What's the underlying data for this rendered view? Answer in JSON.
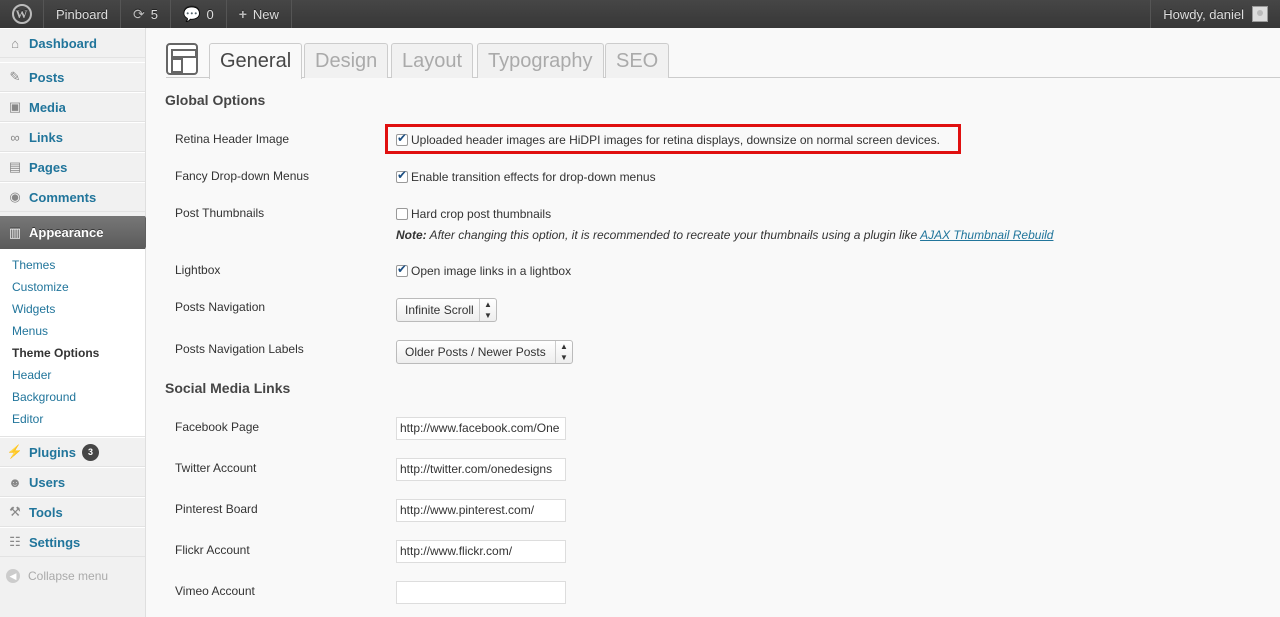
{
  "adminbar": {
    "site_name": "Pinboard",
    "updates_count": "5",
    "comments_count": "0",
    "new_label": "New",
    "howdy": "Howdy, daniel"
  },
  "menu": {
    "dashboard": "Dashboard",
    "posts": "Posts",
    "media": "Media",
    "links": "Links",
    "pages": "Pages",
    "comments": "Comments",
    "appearance": "Appearance",
    "appearance_sub": [
      "Themes",
      "Customize",
      "Widgets",
      "Menus",
      "Theme Options",
      "Header",
      "Background",
      "Editor"
    ],
    "plugins": "Plugins",
    "plugins_badge": "3",
    "users": "Users",
    "tools": "Tools",
    "settings": "Settings",
    "collapse": "Collapse menu"
  },
  "tabs": [
    "General",
    "Design",
    "Layout",
    "Typography",
    "SEO"
  ],
  "global": {
    "heading": "Global Options",
    "retina_label": "Retina Header Image",
    "retina_text": "Uploaded header images are HiDPI images for retina displays, downsize on normal screen devices.",
    "fancy_label": "Fancy Drop-down Menus",
    "fancy_text": "Enable transition effects for drop-down menus",
    "thumbs_label": "Post Thumbnails",
    "thumbs_text": "Hard crop post thumbnails",
    "note_prefix": "Note:",
    "note_text": " After changing this option, it is recommended to recreate your thumbnails using a plugin like ",
    "note_link": "AJAX Thumbnail Rebuild",
    "lightbox_label": "Lightbox",
    "lightbox_text": "Open image links in a lightbox",
    "nav_label": "Posts Navigation",
    "nav_value": "Infinite Scroll",
    "navlabels_label": "Posts Navigation Labels",
    "navlabels_value": "Older Posts / Newer Posts"
  },
  "social": {
    "heading": "Social Media Links",
    "facebook_label": "Facebook Page",
    "facebook_value": "http://www.facebook.com/One",
    "twitter_label": "Twitter Account",
    "twitter_value": "http://twitter.com/onedesigns",
    "pinterest_label": "Pinterest Board",
    "pinterest_value": "http://www.pinterest.com/",
    "flickr_label": "Flickr Account",
    "flickr_value": "http://www.flickr.com/",
    "vimeo_label": "Vimeo Account",
    "vimeo_value": ""
  },
  "colors": {
    "link": "#21759b",
    "highlight": "#e01010",
    "adminbar": "#464646"
  }
}
